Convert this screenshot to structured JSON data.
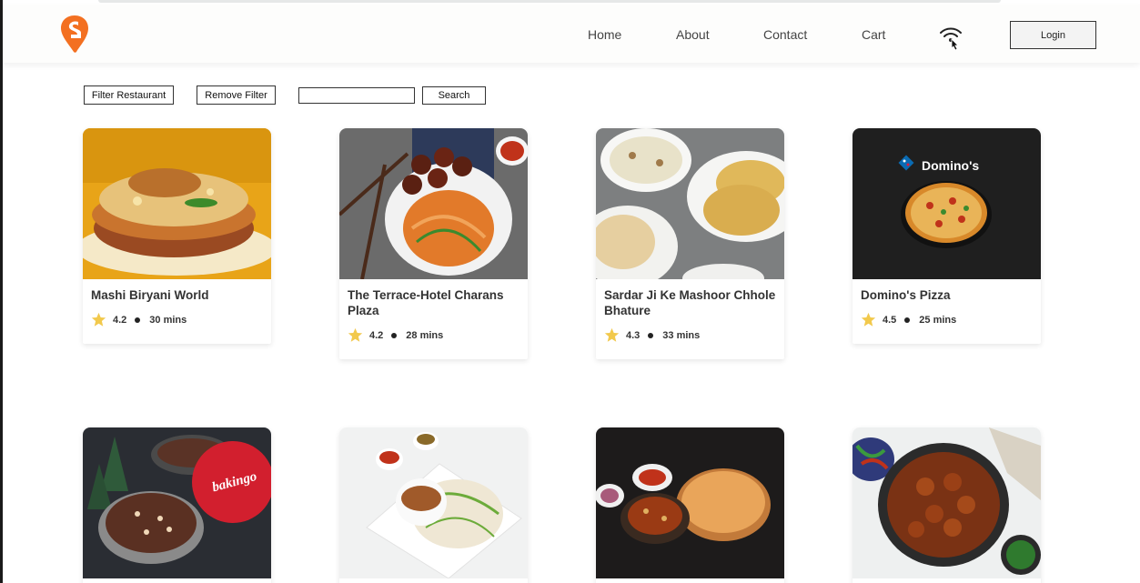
{
  "header": {
    "nav": [
      "Home",
      "About",
      "Contact",
      "Cart"
    ],
    "login_label": "Login",
    "brand_color": "#f37021"
  },
  "toolbar": {
    "filter_label": "Filter Restaurant",
    "remove_label": "Remove Filter",
    "search_value": "",
    "search_label": "Search"
  },
  "restaurants": [
    {
      "name": "Mashi Biryani World",
      "rating": "4.2",
      "time": "30 mins",
      "image": "biryani"
    },
    {
      "name": "The Terrace-Hotel Charans Plaza",
      "rating": "4.2",
      "time": "28 mins",
      "image": "noodles-manchurian"
    },
    {
      "name": "Sardar Ji Ke Mashoor Chhole Bhature",
      "rating": "4.3",
      "time": "33 mins",
      "image": "chhole-bhature"
    },
    {
      "name": "Domino's Pizza",
      "rating": "4.5",
      "time": "25 mins",
      "image": "dominos-pizza",
      "image_text": "Domino's"
    },
    {
      "name": "",
      "rating": "",
      "time": "",
      "image": "bakingo-cake",
      "image_text": "bakingo"
    },
    {
      "name": "",
      "rating": "",
      "time": "",
      "image": "fried-rice"
    },
    {
      "name": "",
      "rating": "",
      "time": "",
      "image": "puri-curry"
    },
    {
      "name": "",
      "rating": "",
      "time": "",
      "image": "chicken-pan"
    }
  ],
  "colors": {
    "star": "#f2c94c",
    "card_shadow": "#e5e5e5"
  }
}
